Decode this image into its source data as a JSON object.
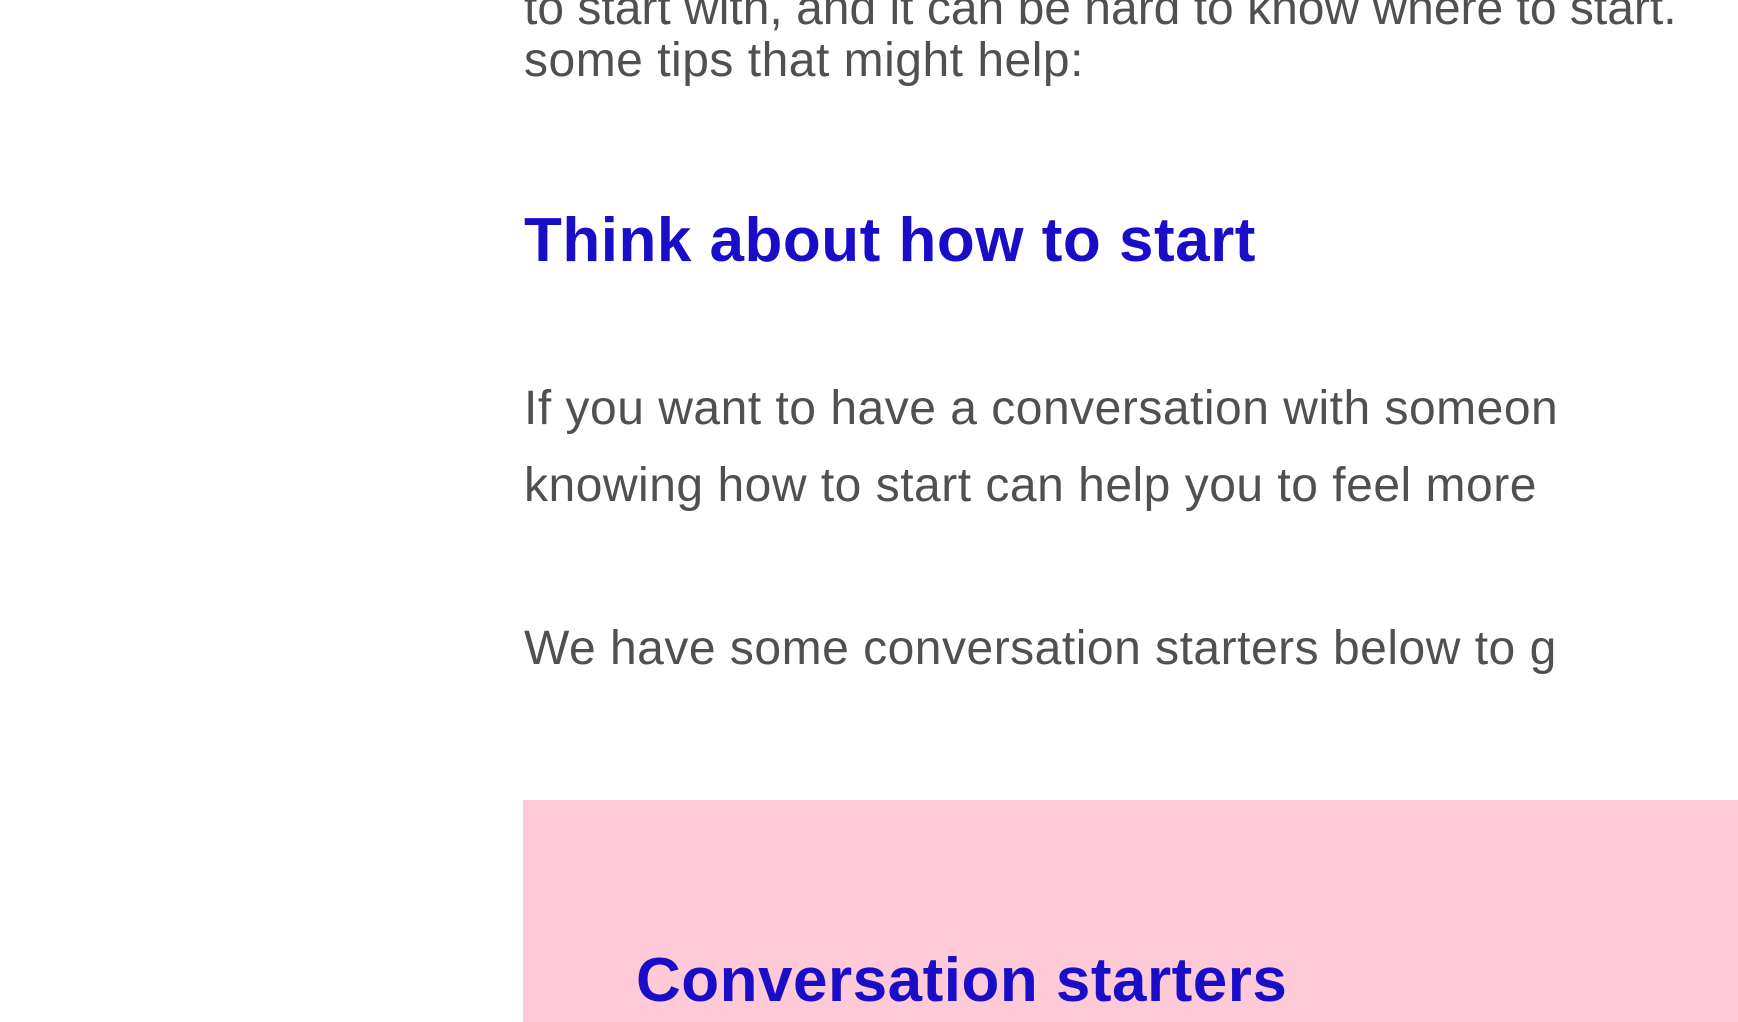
{
  "article": {
    "intro_line_cut": "to start with, and it can be hard to know where to start.",
    "intro_line_2": "some tips that might help:",
    "section_1": {
      "heading": "Think about how to start",
      "para_1_line_1": "If you want to have a conversation with someon",
      "para_1_line_2": "knowing how to start can help you to feel more",
      "para_2_line_1": "We have some conversation starters below to g"
    },
    "starters_box": {
      "heading": "Conversation starters",
      "background": "#ffcad8"
    }
  },
  "colors": {
    "heading": "#1a0dc7",
    "body_text": "#505050",
    "background": "#ffffff"
  }
}
